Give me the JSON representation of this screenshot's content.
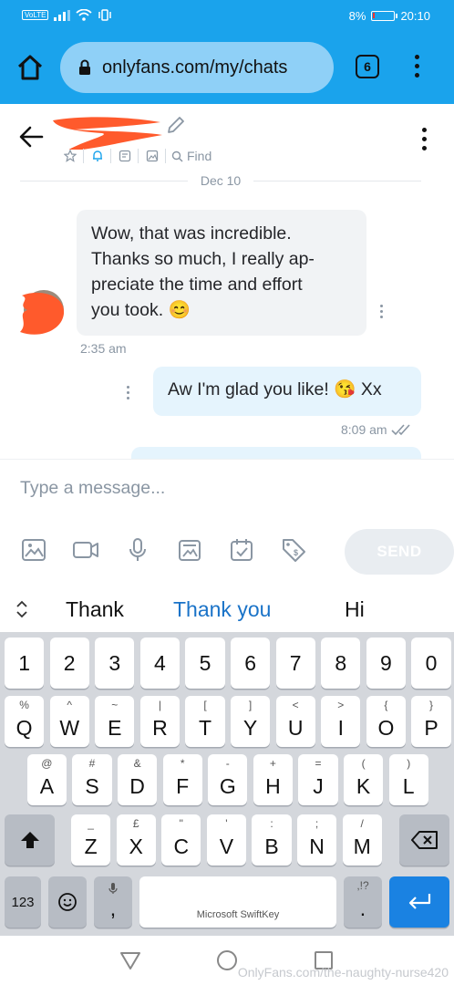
{
  "status_bar": {
    "network": "VoLTE",
    "battery_percent": "8%",
    "time": "20:10"
  },
  "browser": {
    "url": "onlyfans.com/my/chats",
    "tab_count": "6"
  },
  "chat_header": {
    "find_label": "Find"
  },
  "date_divider": "Dec 10",
  "messages": [
    {
      "direction": "incoming",
      "text": "Wow, that was incredible. Thanks so much, I really ap-preciate the time and effort you took. 😊",
      "lines": [
        "Wow, that was incredible.",
        "Thanks so much, I really ap-",
        "preciate the time and effort",
        "you took. 😊"
      ],
      "time": "2:35 am"
    },
    {
      "direction": "outgoing",
      "text": "Aw I'm glad you like! 😘 Xx",
      "time": "8:09 am"
    }
  ],
  "composer": {
    "placeholder": "Type a message...",
    "send_label": "SEND",
    "attachments": [
      "image-icon",
      "video-icon",
      "mic-icon",
      "vault-icon",
      "schedule-icon",
      "price-tag-icon"
    ]
  },
  "keyboard": {
    "suggestions": [
      "Thank",
      "Thank you",
      "Hi"
    ],
    "number_row": [
      "1",
      "2",
      "3",
      "4",
      "5",
      "6",
      "7",
      "8",
      "9",
      "0"
    ],
    "row1": [
      [
        "Q",
        "%"
      ],
      [
        "W",
        "^"
      ],
      [
        "E",
        "~"
      ],
      [
        "R",
        "|"
      ],
      [
        "T",
        "["
      ],
      [
        "Y",
        "]"
      ],
      [
        "U",
        "<"
      ],
      [
        "I",
        ">"
      ],
      [
        "O",
        "{"
      ],
      [
        "P",
        "}"
      ]
    ],
    "row2": [
      [
        "A",
        "@"
      ],
      [
        "S",
        "#"
      ],
      [
        "D",
        "&"
      ],
      [
        "F",
        "*"
      ],
      [
        "G",
        "-"
      ],
      [
        "H",
        "+"
      ],
      [
        "J",
        "="
      ],
      [
        "K",
        "("
      ],
      [
        "L",
        ")"
      ]
    ],
    "row3": [
      [
        "Z",
        "_"
      ],
      [
        "X",
        "£"
      ],
      [
        "C",
        "\""
      ],
      [
        "V",
        "'"
      ],
      [
        "B",
        ":"
      ],
      [
        "N",
        ";"
      ],
      [
        "M",
        "/"
      ]
    ],
    "mode_key": "123",
    "comma_key": ",",
    "period_key": ".",
    "period_hint": ",!?",
    "space_label": "Microsoft SwiftKey"
  },
  "watermark": "OnlyFans.com/the-naughty-nurse420",
  "colors": {
    "browser_bar": "#1aa3ec",
    "incoming_bubble": "#f1f3f5",
    "outgoing_bubble": "#e5f4fd",
    "suggestion_highlight": "#1a73c8",
    "enter_key": "#1a82e2",
    "redaction": "#ff5a2c"
  }
}
